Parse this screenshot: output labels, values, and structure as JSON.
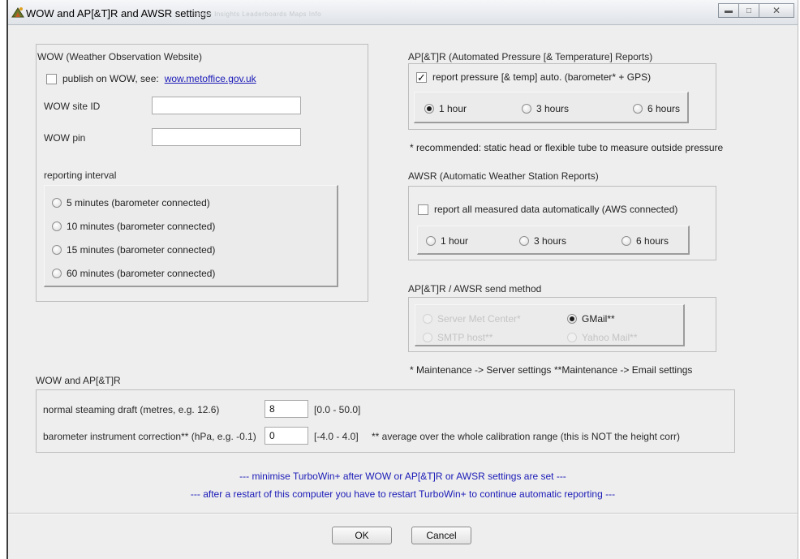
{
  "window": {
    "title": "WOW and AP[&T]R and AWSR settings",
    "ghost_text": "Home  Insights  Leaderboards  Maps  Info"
  },
  "wow": {
    "title": "WOW (Weather Observation Website)",
    "publish_label": "publish on WOW, see:",
    "publish_checked": false,
    "publish_link": "wow.metoffice.gov.uk",
    "site_id_label": "WOW site ID",
    "site_id_value": "",
    "pin_label": "WOW pin",
    "pin_value": "",
    "interval_label": "reporting interval",
    "intervals": [
      "5 minutes (barometer connected)",
      "10 minutes (barometer connected)",
      "15 minutes (barometer connected)",
      "60 minutes (barometer connected)"
    ]
  },
  "aptr": {
    "title": "AP[&T]R (Automated Pressure [& Temperature] Reports)",
    "report_label": "report pressure [& temp] auto. (barometer* + GPS)",
    "report_checked": true,
    "options": [
      "1 hour",
      "3 hours",
      "6 hours"
    ],
    "selected": "1 hour",
    "footnote": "* recommended: static head or flexible tube to measure outside pressure"
  },
  "awsr": {
    "title": "AWSR (Automatic Weather Station Reports)",
    "report_label": "report all measured data automatically (AWS connected)",
    "report_checked": false,
    "options": [
      "1 hour",
      "3 hours",
      "6 hours"
    ]
  },
  "send": {
    "title": "AP[&T]R / AWSR send method",
    "options": [
      "Server Met Center*",
      "GMail**",
      "SMTP host**",
      "Yahoo Mail**"
    ],
    "selected": "GMail**",
    "footnote_1": "* Maintenance -> Server settings",
    "footnote_2": "**Maintenance -> Email settings"
  },
  "common": {
    "title": "WOW and  AP[&T]R",
    "draft_label": "normal steaming draft (metres, e.g. 12.6)",
    "draft_value": "8",
    "draft_range": "[0.0 - 50.0]",
    "baro_label": "barometer instrument correction** (hPa, e.g. -0.1)",
    "baro_value": "0",
    "baro_range": "[-4.0 - 4.0]",
    "baro_note": "** average over the whole calibration range (this is NOT the height corr)"
  },
  "notes": {
    "line1": "--- minimise TurboWin+ after WOW or AP[&T]R or AWSR settings are set ---",
    "line2": "--- after a restart of this computer you have to restart TurboWin+ to continue automatic reporting ---"
  },
  "buttons": {
    "ok": "OK",
    "cancel": "Cancel"
  },
  "colors": {
    "link": "#1a1ab8",
    "dialog_bg": "#eeeeee"
  }
}
